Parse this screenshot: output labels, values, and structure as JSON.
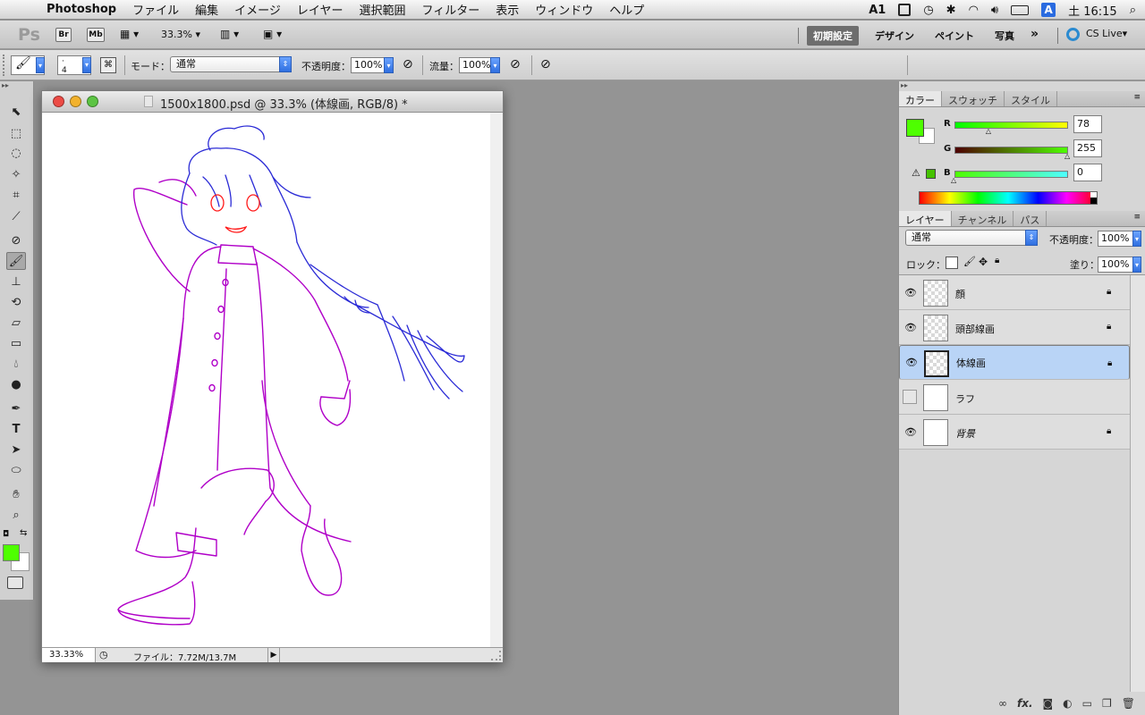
{
  "menubar": {
    "app_name": "Photoshop",
    "items": [
      "ファイル",
      "編集",
      "イメージ",
      "レイヤー",
      "選択範囲",
      "フィルター",
      "表示",
      "ウィンドウ",
      "ヘルプ"
    ],
    "status": {
      "input_label": "1",
      "clock": "土 16:15",
      "input_badge": "A"
    }
  },
  "appbar": {
    "logo": "Ps",
    "bridge": "Br",
    "minibridge": "Mb",
    "zoom": "33.3%",
    "workspaces": [
      "初期設定",
      "デザイン",
      "ペイント",
      "写真"
    ],
    "active_workspace": "初期設定",
    "more": "»",
    "cslive": "CS Live"
  },
  "options": {
    "brush_size": "4",
    "mode_label": "モード：",
    "mode_value": "通常",
    "opacity_label": "不透明度：",
    "opacity_value": "100%",
    "flow_label": "流量：",
    "flow_value": "100%"
  },
  "document": {
    "title": "1500x1800.psd @ 33.3% (体線画, RGB/8) *",
    "zoom": "33.33%",
    "file_info": "ファイル：7.72M/13.7M",
    "colors": {
      "body_line": "#b000c8",
      "hair_line": "#2b2bd6",
      "face_line": "#ff1a1a"
    }
  },
  "color_panel": {
    "tabs": [
      "カラー",
      "スウォッチ",
      "スタイル"
    ],
    "active_tab": "カラー",
    "r_label": "R",
    "g_label": "G",
    "b_label": "B",
    "r": "78",
    "g": "255",
    "b": "0",
    "r_fraction": 0.306,
    "g_fraction": 1.0,
    "b_fraction": 0.0,
    "foreground": "#4eff00",
    "background": "#ffffff"
  },
  "layers_panel": {
    "tabs": [
      "レイヤー",
      "チャンネル",
      "パス"
    ],
    "active_tab": "レイヤー",
    "blend_mode": "通常",
    "opacity_label": "不透明度：",
    "opacity_value": "100%",
    "lock_label": "ロック：",
    "fill_label": "塗り：",
    "fill_value": "100%",
    "layers": [
      {
        "name": "顔",
        "visible": true,
        "locked": true,
        "selected": false
      },
      {
        "name": "頭部線画",
        "visible": true,
        "locked": true,
        "selected": false
      },
      {
        "name": "体線画",
        "visible": true,
        "locked": true,
        "selected": true
      },
      {
        "name": "ラフ",
        "visible": false,
        "locked": false,
        "selected": false
      },
      {
        "name": "背景",
        "visible": true,
        "locked": true,
        "selected": false
      }
    ]
  }
}
